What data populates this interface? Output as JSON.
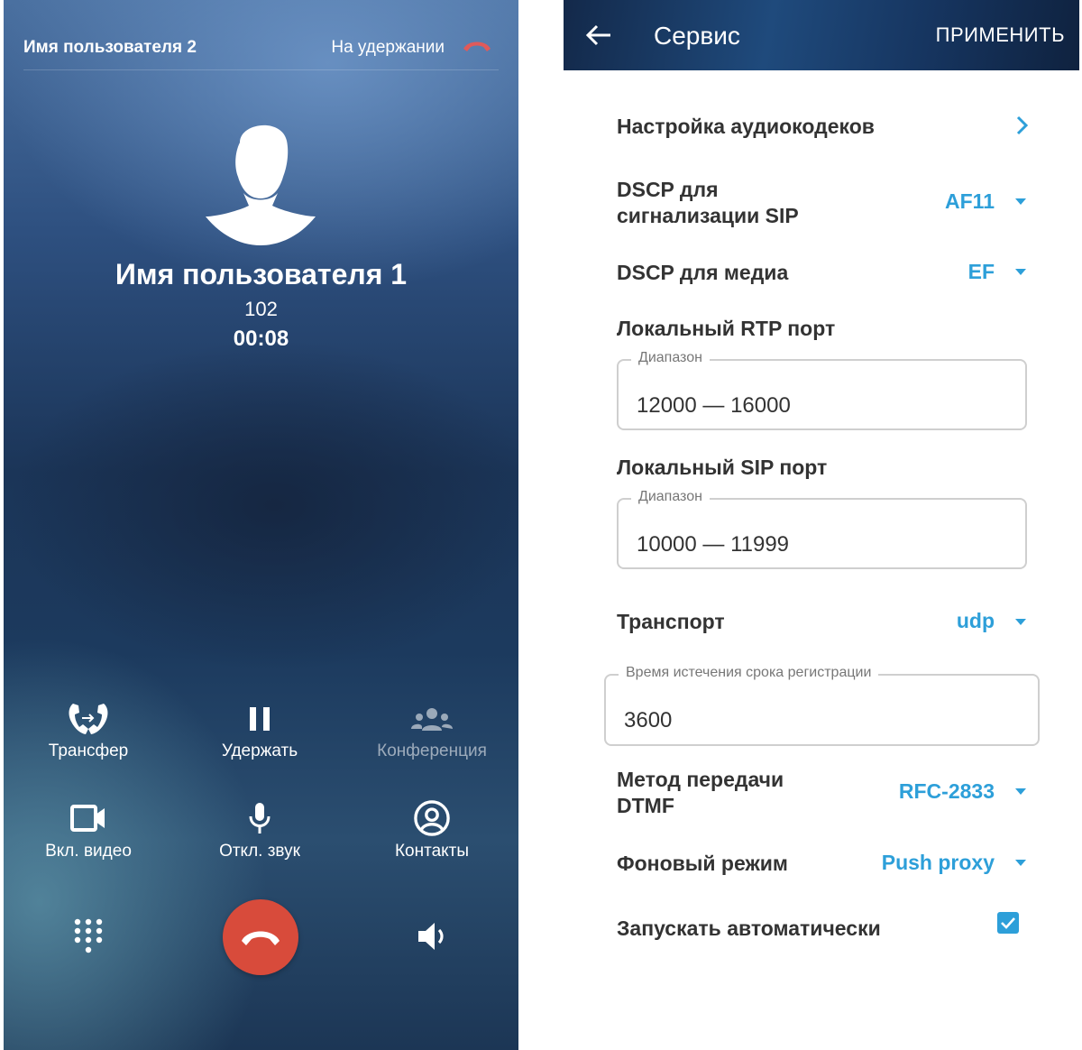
{
  "call": {
    "other_line_name": "Имя пользователя 2",
    "other_line_status": "На удержании",
    "caller_name": "Имя пользователя 1",
    "caller_number": "102",
    "timer": "00:08",
    "actions": {
      "transfer": "Трансфер",
      "hold": "Удержать",
      "conference": "Конференция",
      "video": "Вкл. видео",
      "mute": "Откл. звук",
      "contacts": "Контакты"
    },
    "colors": {
      "end_call": "#d84b3b",
      "hold_hangup_icon": "#e05a5a"
    }
  },
  "settings": {
    "title": "Сервис",
    "apply_label": "ПРИМЕНИТЬ",
    "audio_codecs": "Настройка аудиокодеков",
    "dscp_sip": {
      "label_line1": "DSCP для",
      "label_line2": "сигнализации SIP",
      "value": "AF11"
    },
    "dscp_media": {
      "label": "DSCP для медиа",
      "value": "EF"
    },
    "rtp_port": {
      "label": "Локальный RTP порт",
      "legend": "Диапазон",
      "value": "12000 — 16000"
    },
    "sip_port": {
      "label": "Локальный SIP порт",
      "legend": "Диапазон",
      "value": "10000 — 11999"
    },
    "transport": {
      "label": "Транспорт",
      "value": "udp"
    },
    "registration_expiry": {
      "legend": "Время истечения срока регистрации",
      "value": "3600"
    },
    "dtmf": {
      "label_line1": "Метод передачи",
      "label_line2": "DTMF",
      "value": "RFC-2833"
    },
    "background_mode": {
      "label": "Фоновый режим",
      "value": "Push proxy"
    },
    "autostart": {
      "label": "Запускать автоматически",
      "checked": true
    },
    "colors": {
      "accent": "#2d9fd9",
      "label": "#333333"
    }
  }
}
